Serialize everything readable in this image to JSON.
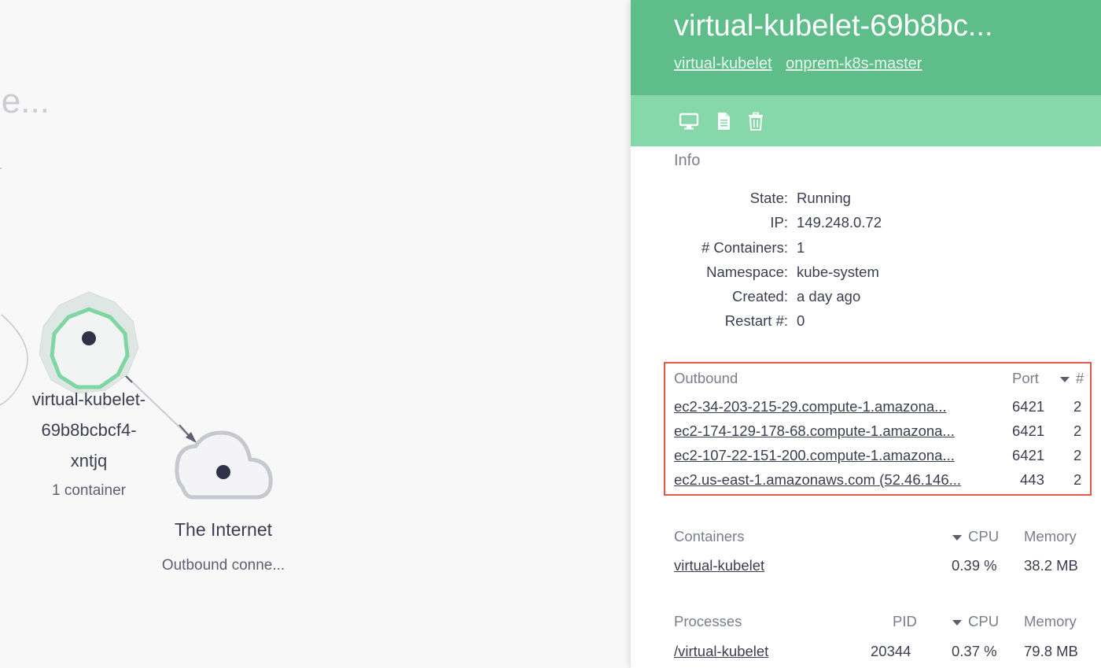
{
  "canvas": {
    "bg_title": "le...",
    "pod_node": {
      "label_lines": [
        "virtual-kubelet-",
        "69b8bcbcf4-",
        "xntjq"
      ],
      "subtitle": "1 container"
    },
    "internet_node": {
      "label": "The Internet",
      "subtitle": "Outbound conne..."
    }
  },
  "panel": {
    "title": "virtual-kubelet-69b8bc...",
    "links": [
      "virtual-kubelet",
      "onprem-k8s-master"
    ],
    "toolbar": {
      "icons": [
        "monitor-icon",
        "document-icon",
        "trash-icon"
      ]
    },
    "info": {
      "title": "Info",
      "rows": [
        {
          "key": "State:",
          "value": "Running"
        },
        {
          "key": "IP:",
          "value": "149.248.0.72"
        },
        {
          "key": "# Containers:",
          "value": "1"
        },
        {
          "key": "Namespace:",
          "value": "kube-system"
        },
        {
          "key": "Created:",
          "value": "a day ago"
        },
        {
          "key": "Restart #:",
          "value": "0"
        }
      ]
    },
    "outbound": {
      "headers": [
        "Outbound",
        "Port",
        "#"
      ],
      "rows": [
        {
          "host": "ec2-34-203-215-29.compute-1.amazona...",
          "port": "6421",
          "count": "2"
        },
        {
          "host": "ec2-174-129-178-68.compute-1.amazona...",
          "port": "6421",
          "count": "2"
        },
        {
          "host": "ec2-107-22-151-200.compute-1.amazona...",
          "port": "6421",
          "count": "2"
        },
        {
          "host": "ec2.us-east-1.amazonaws.com (52.46.146...",
          "port": "443",
          "count": "2"
        }
      ]
    },
    "containers": {
      "headers": [
        "Containers",
        "CPU",
        "Memory"
      ],
      "rows": [
        {
          "name": "virtual-kubelet",
          "cpu": "0.39 %",
          "memory": "38.2 MB"
        }
      ]
    },
    "processes": {
      "headers": [
        "Processes",
        "PID",
        "CPU",
        "Memory"
      ],
      "rows": [
        {
          "name": "/virtual-kubelet",
          "pid": "20344",
          "cpu": "0.37 %",
          "memory": "79.8 MB"
        }
      ]
    }
  },
  "colors": {
    "header_green": "#5ebd89",
    "toolbar_green": "#86d7a9",
    "node_ring": "#7fd6a2",
    "highlight_border": "#e05a47"
  }
}
